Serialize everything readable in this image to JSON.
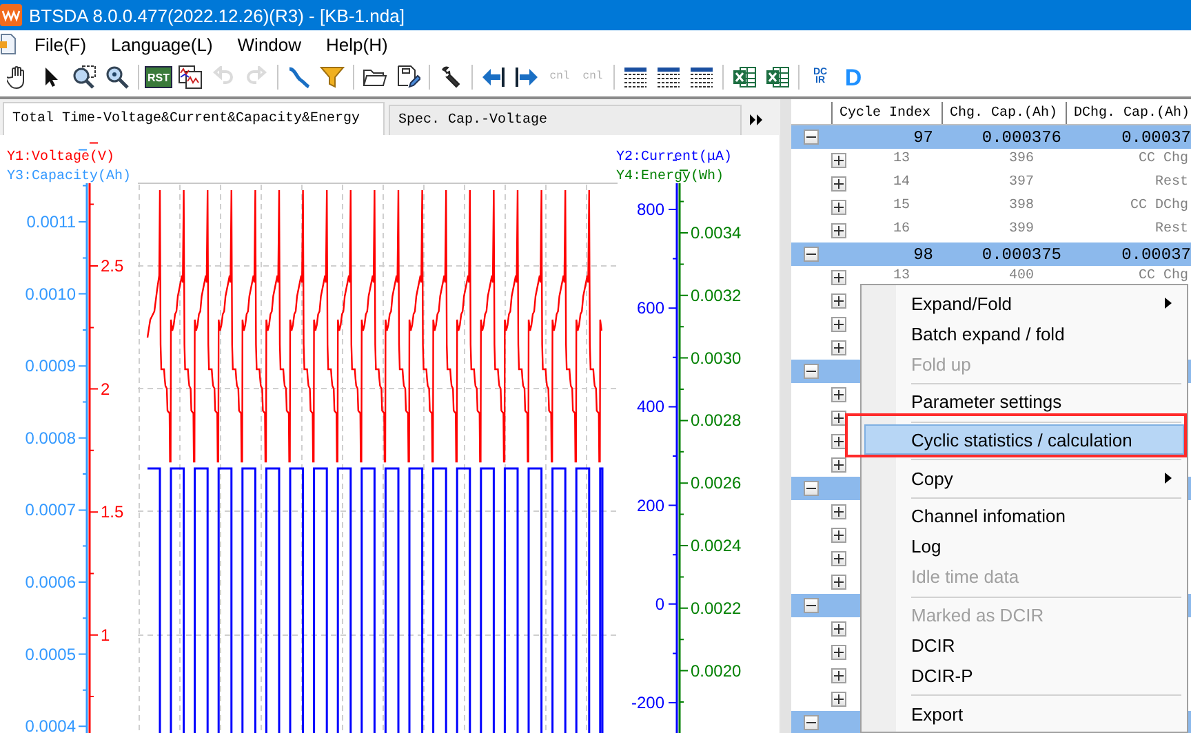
{
  "window": {
    "title": "BTSDA 8.0.0.477(2022.12.26)(R3) - [KB-1.nda]"
  },
  "menu_bar": [
    "File(F)",
    "Language(L)",
    "Window",
    "Help(H)"
  ],
  "toolbar": [
    {
      "kind": "hand",
      "disabled": false
    },
    {
      "kind": "pointer",
      "disabled": false
    },
    {
      "kind": "zoom-box",
      "disabled": false
    },
    {
      "kind": "zoom",
      "disabled": false
    },
    {
      "kind": "separator"
    },
    {
      "kind": "text",
      "label": "RST",
      "disabled": false
    },
    {
      "kind": "chart-doc",
      "disabled": false
    },
    {
      "kind": "undo",
      "disabled": true
    },
    {
      "kind": "redo",
      "disabled": true
    },
    {
      "kind": "separator"
    },
    {
      "kind": "line",
      "disabled": false
    },
    {
      "kind": "filter",
      "disabled": false
    },
    {
      "kind": "separator"
    },
    {
      "kind": "folder",
      "disabled": false
    },
    {
      "kind": "save-edit",
      "disabled": false
    },
    {
      "kind": "separator"
    },
    {
      "kind": "wrench",
      "disabled": false
    },
    {
      "kind": "separator"
    },
    {
      "kind": "arrow-left",
      "disabled": false
    },
    {
      "kind": "arrow-right",
      "disabled": false
    },
    {
      "kind": "small-text",
      "label": "cnl",
      "disabled": true
    },
    {
      "kind": "small-text",
      "label": "cnl",
      "disabled": true
    },
    {
      "kind": "separator"
    },
    {
      "kind": "table",
      "disabled": false
    },
    {
      "kind": "table",
      "disabled": false
    },
    {
      "kind": "table",
      "disabled": false
    },
    {
      "kind": "separator"
    },
    {
      "kind": "sheet",
      "disabled": false
    },
    {
      "kind": "sheet",
      "disabled": false
    },
    {
      "kind": "separator"
    },
    {
      "kind": "stacked-text",
      "label": "DC IR",
      "disabled": false
    },
    {
      "kind": "big-text",
      "label": "D",
      "disabled": false
    }
  ],
  "chart_tabs": [
    {
      "label": "Total Time-Voltage&Current&Capacity&Energy",
      "selected": true
    },
    {
      "label": "Spec. Cap.-Voltage",
      "selected": false
    }
  ],
  "chart": {
    "axes": [
      {
        "kind": "y1",
        "title": "Y1:Voltage(V)",
        "color": "#ff0000",
        "ticks": [
          "2.5",
          "2",
          "1.5",
          "1"
        ]
      },
      {
        "kind": "y3",
        "title": "Y3:Capacity(Ah)",
        "color": "#3399ff",
        "ticks": [
          "0.0011",
          "0.0010",
          "0.0009",
          "0.0008",
          "0.0007",
          "0.0006",
          "0.0005",
          "0.0004"
        ]
      },
      {
        "kind": "y2",
        "title": "Y2:Current(μA)",
        "color": "#0000ff",
        "ticks": [
          "800",
          "600",
          "400",
          "200",
          "0",
          "-200"
        ]
      },
      {
        "kind": "y4",
        "title": "Y4:Energy(Wh)",
        "color": "#008000",
        "ticks": [
          "0.0034",
          "0.0032",
          "0.0030",
          "0.0028",
          "0.0026",
          "0.0024",
          "0.0022",
          "0.0020"
        ]
      }
    ]
  },
  "table": {
    "columns": [
      "Cycle Index",
      "Chg. Cap.(Ah)",
      "DChg. Cap.(Ah)"
    ],
    "rows": [
      {
        "cycle_index": "97",
        "chg_cap": "0.000376",
        "dchg_cap": "0.00037",
        "expanded": true,
        "children": [
          {
            "cycle_index": "13",
            "chg_cap": "396",
            "dchg_cap": "CC Chg",
            "expanded": false
          },
          {
            "cycle_index": "14",
            "chg_cap": "397",
            "dchg_cap": "Rest",
            "expanded": false
          },
          {
            "cycle_index": "15",
            "chg_cap": "398",
            "dchg_cap": "CC DChg",
            "expanded": false
          },
          {
            "cycle_index": "16",
            "chg_cap": "399",
            "dchg_cap": "Rest",
            "expanded": false
          }
        ]
      },
      {
        "cycle_index": "98",
        "chg_cap": "0.000375",
        "dchg_cap": "0.00037",
        "expanded": true,
        "children": [
          {
            "cycle_index": "13",
            "chg_cap": "400",
            "dchg_cap": "CC Chg",
            "expanded": false
          },
          {
            "expanded": false
          },
          {
            "expanded": false
          },
          {
            "expanded": false
          }
        ]
      },
      {
        "expanded": true,
        "children": [
          {
            "expanded": false
          },
          {
            "expanded": false
          },
          {
            "expanded": false
          },
          {
            "expanded": false
          }
        ]
      },
      {
        "expanded": true,
        "children": [
          {
            "expanded": false
          },
          {
            "expanded": false
          },
          {
            "expanded": false
          },
          {
            "expanded": false
          }
        ]
      },
      {
        "expanded": true,
        "children": [
          {
            "expanded": false
          },
          {
            "expanded": false
          },
          {
            "expanded": false
          },
          {
            "expanded": false
          }
        ]
      },
      {
        "expanded": true
      }
    ]
  },
  "context_menu": [
    {
      "kind": "item",
      "label": "Expand/Fold",
      "disabled": false,
      "submenu": true,
      "selected": false,
      "annotated": false
    },
    {
      "kind": "item",
      "label": "Batch expand / fold",
      "disabled": false,
      "submenu": false,
      "selected": false,
      "annotated": false
    },
    {
      "kind": "item",
      "label": "Fold up",
      "disabled": true,
      "submenu": false,
      "selected": false,
      "annotated": false
    },
    {
      "kind": "separator"
    },
    {
      "kind": "item",
      "label": "Parameter settings",
      "disabled": false,
      "submenu": false,
      "selected": false,
      "annotated": false
    },
    {
      "kind": "separator"
    },
    {
      "kind": "item",
      "label": "Cyclic statistics / calculation",
      "disabled": false,
      "submenu": false,
      "selected": true,
      "annotated": true
    },
    {
      "kind": "separator"
    },
    {
      "kind": "item",
      "label": "Copy",
      "disabled": false,
      "submenu": true,
      "selected": false,
      "annotated": false
    },
    {
      "kind": "separator"
    },
    {
      "kind": "item",
      "label": "Channel infomation",
      "disabled": false,
      "submenu": false,
      "selected": false,
      "annotated": false
    },
    {
      "kind": "item",
      "label": "Log",
      "disabled": false,
      "submenu": false,
      "selected": false,
      "annotated": false
    },
    {
      "kind": "item",
      "label": "Idle time data",
      "disabled": true,
      "submenu": false,
      "selected": false,
      "annotated": false
    },
    {
      "kind": "separator"
    },
    {
      "kind": "item",
      "label": "Marked as DCIR",
      "disabled": true,
      "submenu": false,
      "selected": false,
      "annotated": false
    },
    {
      "kind": "item",
      "label": "DCIR",
      "disabled": false,
      "submenu": false,
      "selected": false,
      "annotated": false
    },
    {
      "kind": "item",
      "label": "DCIR-P",
      "disabled": false,
      "submenu": false,
      "selected": false,
      "annotated": false
    },
    {
      "kind": "separator"
    },
    {
      "kind": "item",
      "label": "Export",
      "disabled": false,
      "submenu": false,
      "selected": false,
      "annotated": false
    }
  ]
}
